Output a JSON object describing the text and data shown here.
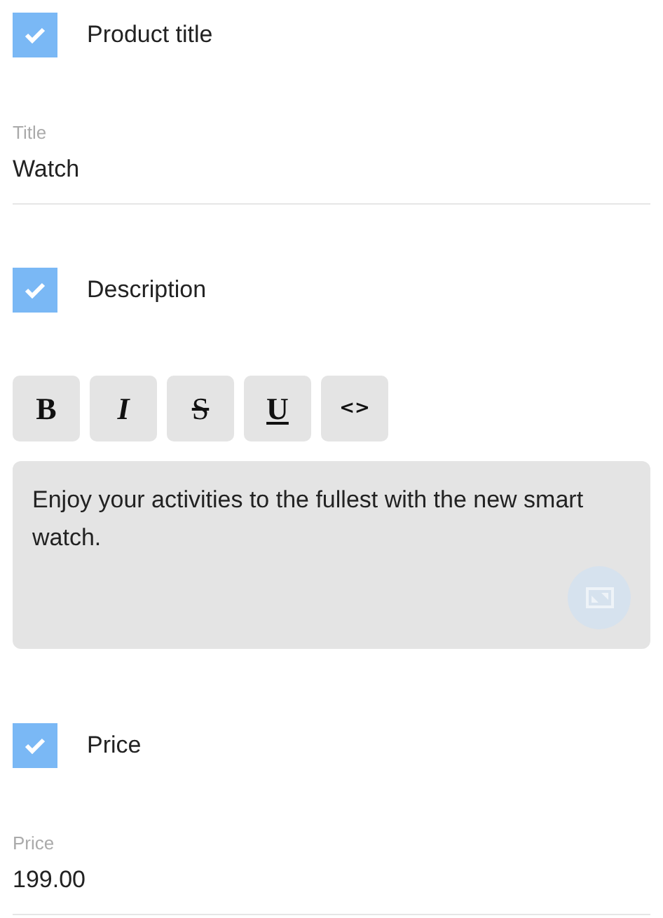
{
  "sections": [
    {
      "kind": "checkbox",
      "label": "Product title",
      "checked": true
    },
    {
      "kind": "field",
      "label": "Title",
      "value": "Watch"
    },
    {
      "kind": "checkbox",
      "label": "Description",
      "checked": true
    },
    {
      "kind": "toolbar",
      "buttons": [
        {
          "label": "B",
          "kind": "bold"
        },
        {
          "label": "I",
          "kind": "italic"
        },
        {
          "label": "S",
          "kind": "strike"
        },
        {
          "label": "U",
          "kind": "underline"
        },
        {
          "label": "<>",
          "kind": "code"
        }
      ]
    },
    {
      "kind": "editor",
      "value": "Enjoy your activities to the fullest with the new smart watch."
    },
    {
      "kind": "checkbox",
      "label": "Price",
      "checked": true
    },
    {
      "kind": "field",
      "label": "Price",
      "value": "199.00"
    }
  ]
}
